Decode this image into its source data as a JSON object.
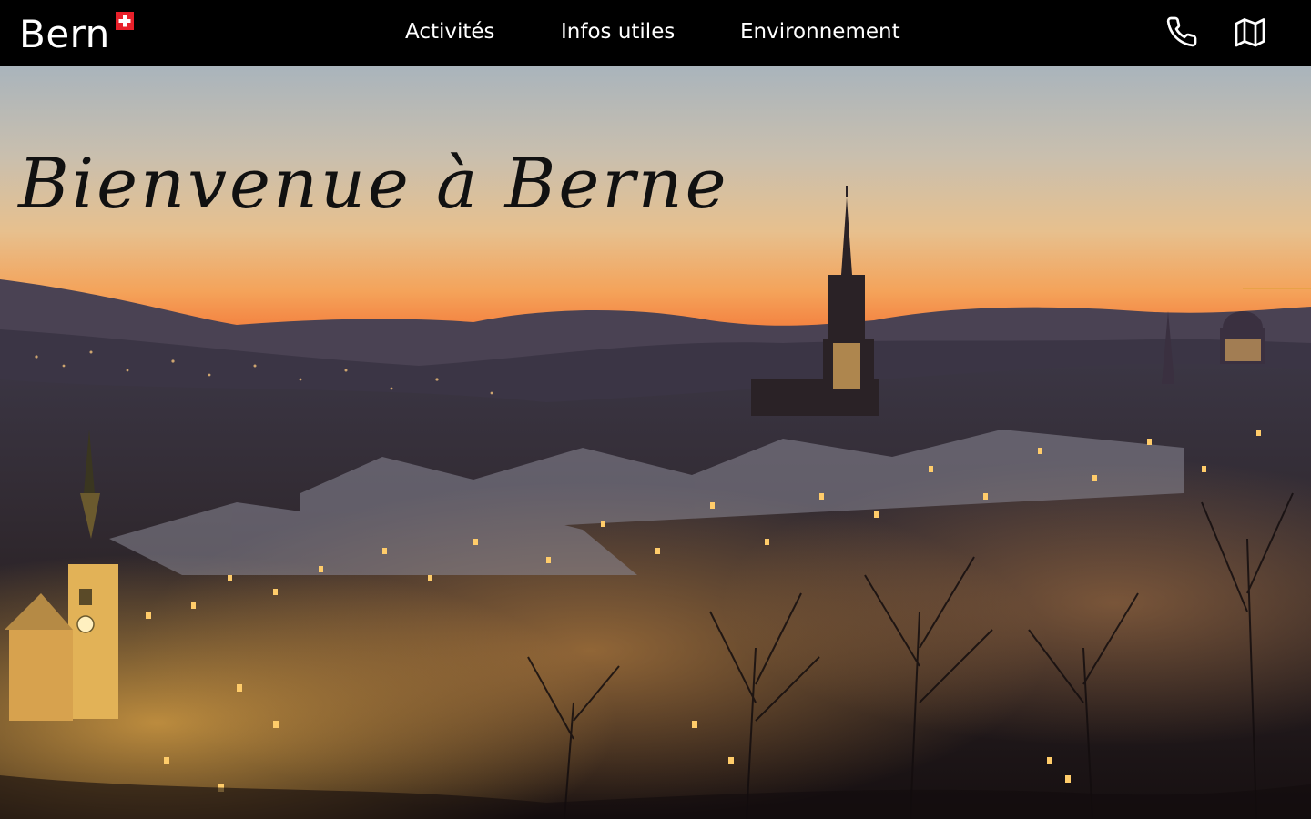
{
  "header": {
    "logo_text": "Bern",
    "nav": [
      {
        "label": "Activités"
      },
      {
        "label": "Infos utiles"
      },
      {
        "label": "Environnement"
      }
    ],
    "icons": {
      "phone": "phone-icon",
      "map": "map-icon",
      "flag": "swiss-flag-icon"
    }
  },
  "hero": {
    "title": "Bienvenue à Berne",
    "image": "bern-winter-sunset-panorama"
  },
  "colors": {
    "header_bg": "#000000",
    "nav_text": "#ffffff",
    "flag_red": "#e8202a",
    "title_text": "#111111"
  }
}
